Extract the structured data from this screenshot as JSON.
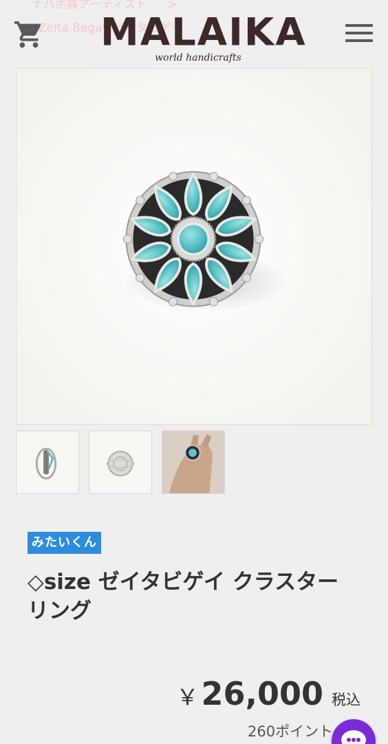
{
  "header": {
    "breadcrumb_line1": "ナバホ族アーティスト",
    "breadcrumb_sep": ">",
    "breadcrumb_line2": "Zelta Begay ゼイタビゲイ",
    "logo_main": "MALAIKA",
    "logo_sub": "world handicrafts",
    "cart_icon": "cart-icon",
    "menu_icon": "hamburger-menu-icon"
  },
  "gallery": {
    "main_image": "turquoise-cluster-ring-photo",
    "thumbnails": [
      "ring-side-view",
      "ring-back-view",
      "ring-on-hand"
    ]
  },
  "product": {
    "tag": "みたいくん",
    "title": "◇size ゼイタビゲイ クラスター リング",
    "price_yen": "￥",
    "price": "26,000",
    "tax_label": "税込",
    "points": "260ポイント"
  },
  "colors": {
    "brand": "#3e2829",
    "tag_bg": "#2f8bde",
    "chat_bg": "#7a2bd8",
    "turquoise": "#5fc6c9"
  }
}
